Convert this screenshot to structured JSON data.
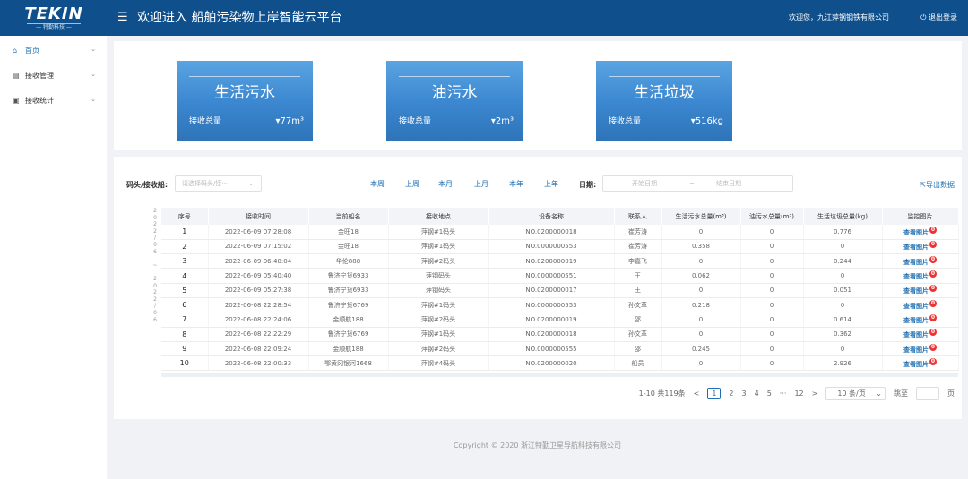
{
  "header": {
    "logo": "TEKIN",
    "logo_sub": "— 特勤科技 —",
    "menu_icon": "menu-fold-icon",
    "title": "欢迎进入 船舶污染物上岸智能云平台",
    "welcome": "欢迎您，九江萍钢钢铁有限公司",
    "logout": "退出登录"
  },
  "sidebar": {
    "items": [
      {
        "label": "首页",
        "icon": "home-icon",
        "active": true
      },
      {
        "label": "接收管理",
        "icon": "document-icon",
        "active": false
      },
      {
        "label": "接收统计",
        "icon": "chart-icon",
        "active": false
      }
    ]
  },
  "summary": {
    "cards": [
      {
        "name": "生活污水",
        "label": "接收总量",
        "value": "77m³",
        "trend_icon": "caret-down-icon"
      },
      {
        "name": "油污水",
        "label": "接收总量",
        "value": "2m³",
        "trend_icon": "caret-down-icon"
      },
      {
        "name": "生活垃圾",
        "label": "接收总量",
        "value": "516kg",
        "trend_icon": "caret-down-icon"
      }
    ]
  },
  "filter": {
    "dock_label": "码头/接收船:",
    "dock_placeholder": "请选择码头/接···",
    "periods": [
      "本周",
      "上周",
      "本月",
      "上月",
      "本年",
      "上年"
    ],
    "date_label": "日期:",
    "start_placeholder": "开始日期",
    "separator": "~",
    "end_placeholder": "结束日期",
    "export": "导出数据"
  },
  "side_values": "2\n0\n2\n2\n/\n0\n6\n\n~\n\n2\n0\n2\n2\n/\n0\n6",
  "table": {
    "headers": [
      "序号",
      "接收时间",
      "当前船名",
      "接收地点",
      "设备名称",
      "联系人",
      "生活污水总量(m³)",
      "油污水总量(m³)",
      "生活垃圾总量(kg)",
      "监控图片"
    ],
    "rows": [
      [
        "1",
        "2022-06-09 07:28:08",
        "金旺18",
        "萍钢#1码头",
        "NO.0200000018",
        "崔芳涛",
        "0",
        "0",
        "0.776",
        "查看图片",
        "0"
      ],
      [
        "2",
        "2022-06-09 07:15:02",
        "金旺18",
        "萍钢#1码头",
        "NO.0000000553",
        "崔芳涛",
        "0.358",
        "0",
        "0",
        "查看图片",
        "0"
      ],
      [
        "3",
        "2022-06-09 06:48:04",
        "华伦888",
        "萍钢#2码头",
        "NO.0200000019",
        "李嘉飞",
        "0",
        "0",
        "0.244",
        "查看图片",
        "0"
      ],
      [
        "4",
        "2022-06-09 05:40:40",
        "鲁济宁货6933",
        "萍钢码头",
        "NO.0000000551",
        "王",
        "0.062",
        "0",
        "0",
        "查看图片",
        "0"
      ],
      [
        "5",
        "2022-06-09 05:27:38",
        "鲁济宁货6933",
        "萍钢码头",
        "NO.0200000017",
        "王",
        "0",
        "0",
        "0.051",
        "查看图片",
        "0"
      ],
      [
        "6",
        "2022-06-08 22:28:54",
        "鲁济宁货6769",
        "萍钢#1码头",
        "NO.0000000553",
        "孙文革",
        "0.218",
        "0",
        "0",
        "查看图片",
        "0"
      ],
      [
        "7",
        "2022-06-08 22:24:06",
        "金顺航188",
        "萍钢#2码头",
        "NO.0200000019",
        "邵",
        "0",
        "0",
        "0.614",
        "查看图片",
        "0"
      ],
      [
        "8",
        "2022-06-08 22:22:29",
        "鲁济宁货6769",
        "萍钢#1码头",
        "NO.0200000018",
        "孙文革",
        "0",
        "0",
        "0.362",
        "查看图片",
        "0"
      ],
      [
        "9",
        "2022-06-08 22:09:24",
        "金顺航188",
        "萍钢#2码头",
        "NO.0000000555",
        "邵",
        "0.245",
        "0",
        "0",
        "查看图片",
        "0"
      ],
      [
        "10",
        "2022-06-08 22:00:33",
        "鄂黄冈银河1668",
        "萍钢#4码头",
        "NO.0200000020",
        "船员",
        "0",
        "0",
        "2.926",
        "查看图片",
        "0"
      ]
    ]
  },
  "pagination": {
    "summary": "1-10 共119条",
    "prev": "<",
    "pages": [
      "1",
      "2",
      "3",
      "4",
      "5",
      "···",
      "12"
    ],
    "current": "1",
    "next": ">",
    "page_size": "10 条/页",
    "goto_label": "跳至",
    "goto_unit": "页"
  },
  "footer": "Copyright © 2020 浙江特勤卫星导航科技有限公司"
}
